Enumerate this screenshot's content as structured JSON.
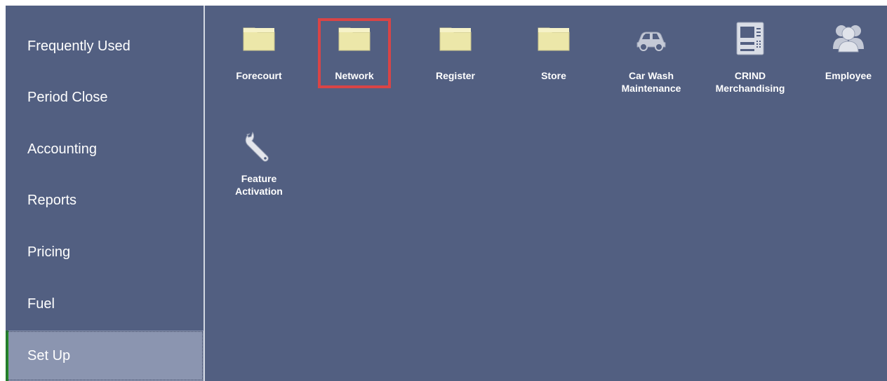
{
  "sidebar": {
    "items": [
      {
        "label": "Frequently Used"
      },
      {
        "label": "Period Close"
      },
      {
        "label": "Accounting"
      },
      {
        "label": "Reports"
      },
      {
        "label": "Pricing"
      },
      {
        "label": "Fuel"
      },
      {
        "label": "Set Up",
        "selected": true
      }
    ]
  },
  "tiles": [
    {
      "icon": "folder-icon",
      "label": "Forecourt"
    },
    {
      "icon": "folder-icon",
      "label": "Network",
      "highlighted": true
    },
    {
      "icon": "folder-icon",
      "label": "Register"
    },
    {
      "icon": "folder-icon",
      "label": "Store"
    },
    {
      "icon": "car-icon",
      "label_line1": "Car Wash",
      "label_line2": "Maintenance"
    },
    {
      "icon": "atm-icon",
      "label_line1": "CRIND",
      "label_line2": "Merchandising"
    },
    {
      "icon": "people-icon",
      "label": "Employee"
    },
    {
      "icon": "wrench-icon",
      "label_line1": "Feature",
      "label_line2": "Activation"
    }
  ],
  "colors": {
    "background": "#525f81",
    "selected_item": "#8b95b0",
    "selected_accent": "#1f8b1f",
    "highlight_border": "#d94446",
    "folder": "#ece7a9"
  }
}
